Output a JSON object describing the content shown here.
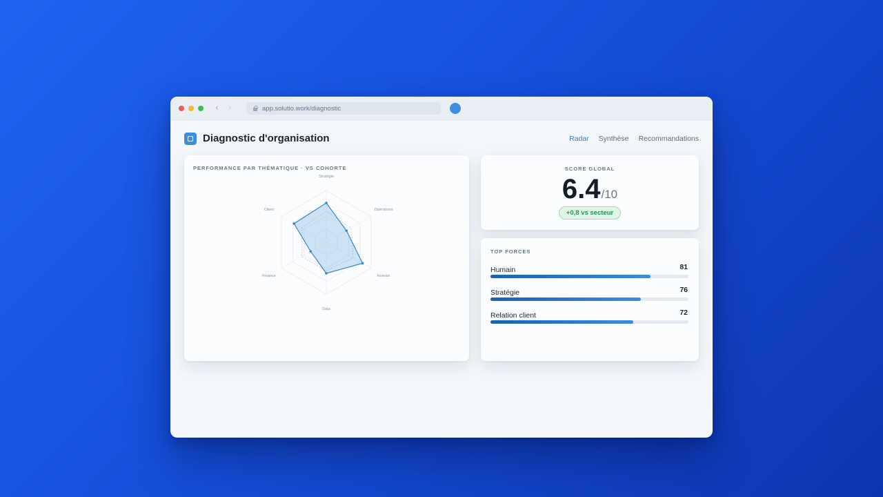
{
  "browser": {
    "url": "app.solutio.work/diagnostic"
  },
  "header": {
    "title": "Diagnostic d'organisation",
    "tabs": [
      {
        "label": "Radar",
        "active": true
      },
      {
        "label": "Synthèse",
        "active": false
      },
      {
        "label": "Recommandations",
        "active": false
      }
    ]
  },
  "radar": {
    "label": "PERFORMANCE PAR THÉMATIQUE · VS COHORTE",
    "axes": [
      "Stratégie",
      "Opérations",
      "Humain",
      "Data",
      "Finance",
      "Client"
    ],
    "scores": [
      0.76,
      0.45,
      0.81,
      0.6,
      0.35,
      0.72
    ],
    "cohort": [
      0.6,
      0.55,
      0.6,
      0.55,
      0.55,
      0.55
    ],
    "colors": {
      "series": "#3a86c8",
      "fill": "rgba(120,180,225,0.35)",
      "cohort": "#b9c3cf"
    }
  },
  "score": {
    "label": "SCORE GLOBAL",
    "value": "6.4",
    "max": "/10",
    "delta": "+0,8 vs secteur"
  },
  "forces": {
    "label": "TOP FORCES",
    "items": [
      {
        "name": "Humain",
        "value": 81
      },
      {
        "name": "Stratégie",
        "value": 76
      },
      {
        "name": "Relation client",
        "value": 72
      }
    ]
  }
}
